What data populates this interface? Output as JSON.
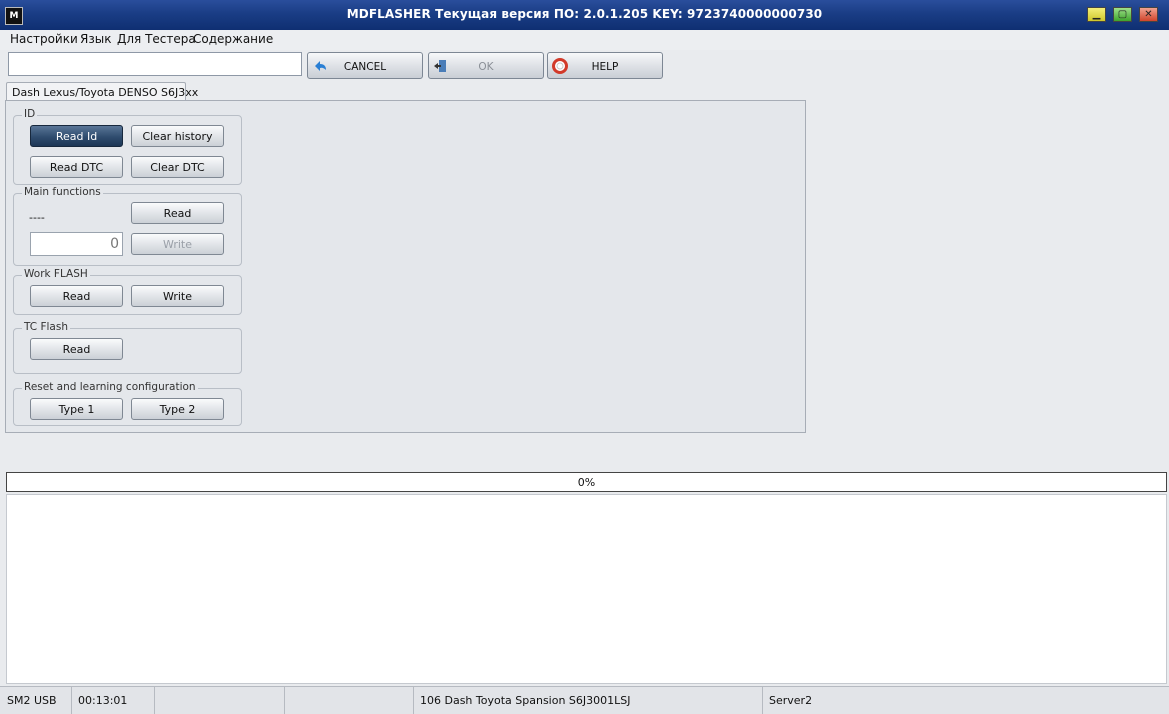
{
  "window": {
    "title": "MDFLASHER  Текущая версия ПО: 2.0.1.205  KEY: 9723740000000730",
    "icon_text": "M"
  },
  "menu": [
    "Настройки",
    "Язык",
    "Для Тестера",
    "Содержание"
  ],
  "toolbar": {
    "input_value": "",
    "cancel_label": "CANCEL",
    "ok_label": "OK",
    "help_label": "HELP",
    "cancel_icon": "back-arrow-icon",
    "ok_icon": "exit-door-icon",
    "help_icon": "lifebuoy-icon"
  },
  "tab": {
    "label": "Dash Lexus/Toyota DENSO S6J3xx"
  },
  "groups": {
    "id": {
      "title": "ID",
      "read_id": "Read Id",
      "clear_history": "Clear history",
      "read_dtc": "Read DTC",
      "clear_dtc": "Clear DTC"
    },
    "main": {
      "title": "Main functions",
      "value_text": "----",
      "input_value": "0",
      "read": "Read",
      "write": "Write"
    },
    "work_flash": {
      "title": "Work FLASH",
      "read": "Read",
      "write": "Write"
    },
    "tc_flash": {
      "title": "TC Flash",
      "read": "Read"
    },
    "reset": {
      "title": "Reset and learning configuration",
      "type1": "Type 1",
      "type2": "Type 2"
    }
  },
  "progress": {
    "percent": 0,
    "label": "0%"
  },
  "status": {
    "interface": "SM2 USB",
    "time": "00:13:01",
    "empty1": "",
    "empty2": "",
    "device": "106 Dash Toyota Spansion S6J3001LSJ",
    "server": "Server2"
  },
  "colors": {
    "titlebar": "#1a3d85",
    "primary_button": "#2f4c6e",
    "background": "#e9ebee"
  }
}
